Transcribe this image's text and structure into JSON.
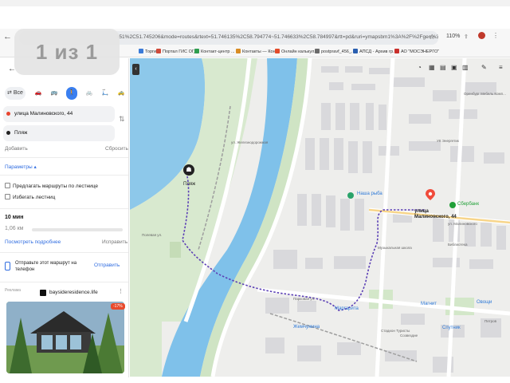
{
  "browser": {
    "url": "l51%2C51.745206&mode=routes&rtext=51.746135%2C58.794774~51.746633%2C58.784997&rtt=pd&ruri=ymapsbm1%3A%2F%2Fgeo%3...",
    "zoom": "110%",
    "bookmarks": [
      "Торги",
      "Портал ГИС ОГД",
      "Контакт-центр ...",
      "Контакты — Кон...",
      "Онлайн калькул...",
      "postpravf_456_...",
      "АПСД - Архив гр...",
      "АО \"МОСЭНЕРГО\""
    ]
  },
  "pager": {
    "text": "1 из 1"
  },
  "sidebar": {
    "mode_all": "Все",
    "from": "улица Малиновского, 44",
    "to": "Пляж",
    "add": "Добавить",
    "reset": "Сбросить",
    "params": "Параметры ▴",
    "option_ferry": "Предлагать маршруты по лестнице",
    "option_stairs": "Избегать лестниц",
    "duration": "10 мин",
    "distance": "1,06 км",
    "more": "Посмотреть подробнее",
    "fix": "Исправить",
    "send_text": "Отправьте этот маршрут на телефон",
    "send_button": "Отправить",
    "ad_label": "Реклама",
    "ad_domain": "baysideresidence.life",
    "ad_badge": "-17%"
  },
  "map": {
    "beach_label": "Пляж",
    "destination_label": "улица\nМалиновского, 44",
    "labels": {
      "orenburg": "Оренбург Мебель Комп...",
      "uk": "УК Энергетик",
      "fish": "Наша рыба",
      "sber": "Сбербанк",
      "library": "Библиотека",
      "school": "Музыкальная школа",
      "magnit": "Магнит",
      "vegetables": "Овощи",
      "margarita": "Маргарита",
      "zhemchuzhina": "Жемчужина",
      "sputnik": "Спутник",
      "sozvezdie": "Созвездие",
      "street_malinovskogo": "ул. Малиновского",
      "street_parkovaya": "Парковая ул.",
      "street_polevaya": "Полевая ул.",
      "street_zheleznodorozhnaya": "ул. Железнодорожная",
      "tourists": "Стадион Туристы",
      "petrov": "Петров"
    }
  }
}
